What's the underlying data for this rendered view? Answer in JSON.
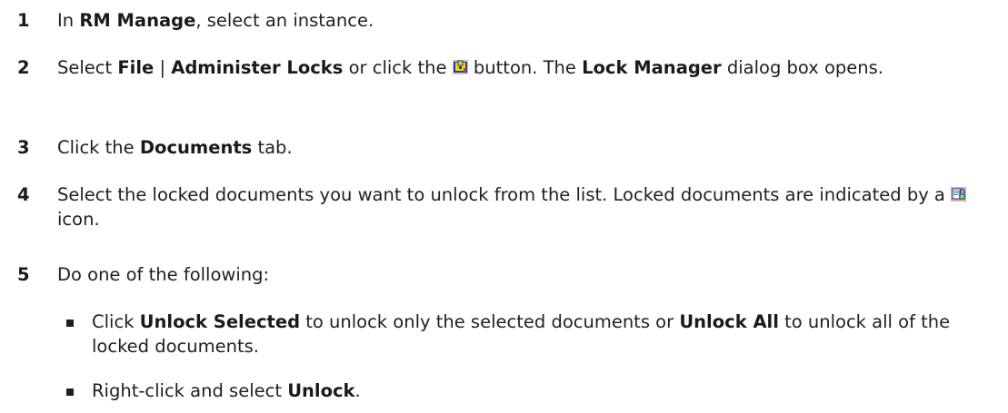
{
  "steps": [
    {
      "number": "1",
      "parts": [
        "In ",
        "RM Manage",
        ", select an instance."
      ]
    },
    {
      "number": "2",
      "parts": [
        "Select ",
        "File",
        " | ",
        "Administer Locks",
        " or click the ",
        " button. The ",
        "Lock Manager",
        " dialog box opens."
      ]
    },
    {
      "number": "3",
      "parts": [
        "Click the ",
        "Documents",
        " tab."
      ]
    },
    {
      "number": "4",
      "parts": [
        "Select the locked documents you want to unlock from the list. Locked documents are indicated by a ",
        " icon."
      ]
    },
    {
      "number": "5",
      "parts": [
        "Do one of the following:"
      ]
    }
  ],
  "bullets": [
    {
      "parts": [
        "Click ",
        "Unlock Selected",
        " to unlock only the selected documents or ",
        "Unlock All",
        " to unlock all of the locked documents."
      ]
    },
    {
      "parts": [
        "Right-click and select ",
        "Unlock",
        "."
      ]
    }
  ],
  "icons": {
    "administer_locks_button": "lock-manager-icon",
    "locked_document": "locked-document-icon"
  },
  "colors": {
    "text": "#1f1f1f",
    "icon_yellow": "#f5d800",
    "icon_blue": "#1f3fa8",
    "icon_red": "#d93b3b",
    "icon_teal": "#2b8c8c"
  }
}
